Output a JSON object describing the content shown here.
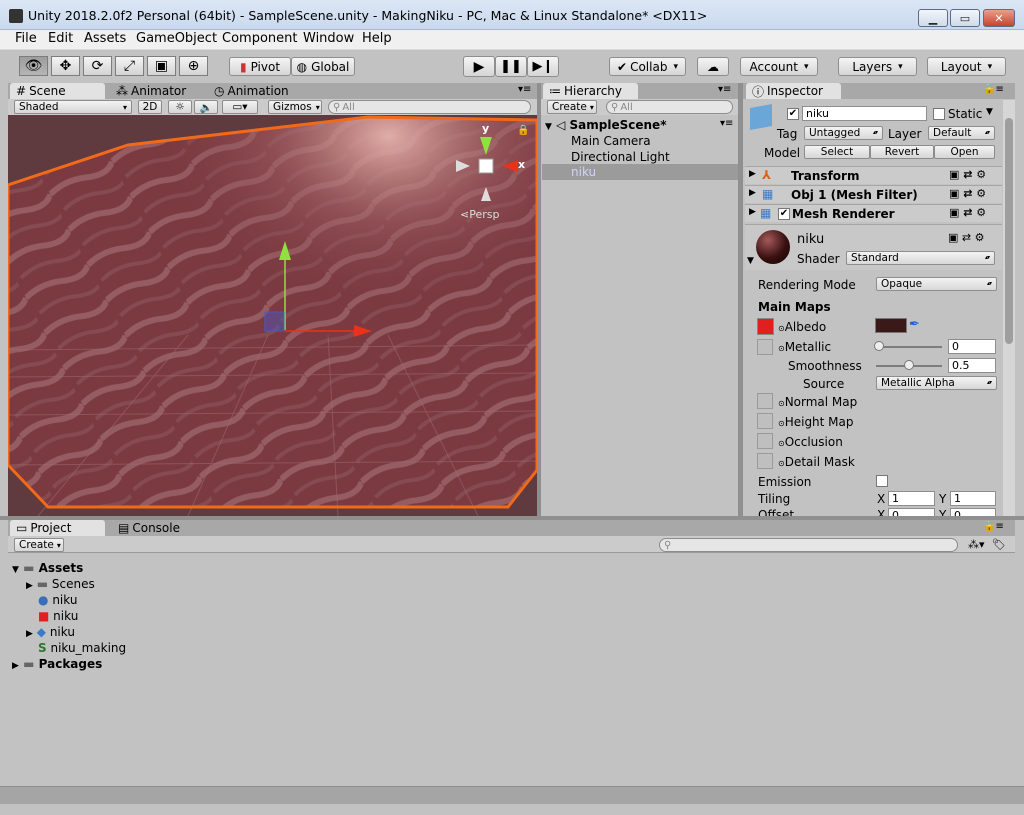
{
  "window": {
    "title": "Unity 2018.2.0f2 Personal (64bit) - SampleScene.unity - MakingNiku - PC, Mac & Linux Standalone* <DX11>",
    "minimize_label": "▁",
    "maximize_label": "▭",
    "close_label": "✕"
  },
  "menu": [
    "File",
    "Edit",
    "Assets",
    "GameObject",
    "Component",
    "Window",
    "Help"
  ],
  "toolbar": {
    "pivot_label": "Pivot",
    "global_label": "Global",
    "collab_label": "Collab",
    "account_label": "Account",
    "layers_label": "Layers",
    "layout_label": "Layout"
  },
  "scene": {
    "tabs": [
      "Scene",
      "Animator",
      "Animation"
    ],
    "shading_mode": "Shaded",
    "mode_2d_label": "2D",
    "gizmos_label": "Gizmos",
    "search_placeholder": "All",
    "projection_label": "Persp",
    "axis_x_label": "x",
    "axis_y_label": "y"
  },
  "hierarchy": {
    "tab_label": "Hierarchy",
    "create_label": "Create",
    "search_placeholder": "All",
    "scene_name": "SampleScene*",
    "items": [
      "Main Camera",
      "Directional Light",
      "niku"
    ],
    "selected_item": "niku"
  },
  "inspector": {
    "tab_label": "Inspector",
    "object_name": "niku",
    "static_label": "Static",
    "tag_label": "Tag",
    "tag_value": "Untagged",
    "layer_label": "Layer",
    "layer_value": "Default",
    "model_label": "Model",
    "model_buttons": [
      "Select",
      "Revert",
      "Open"
    ],
    "components": [
      "Transform",
      "Obj 1 (Mesh Filter)",
      "Mesh Renderer"
    ],
    "material_name": "niku",
    "shader_label": "Shader",
    "shader_value": "Standard",
    "rendering_mode_label": "Rendering Mode",
    "rendering_mode_value": "Opaque",
    "main_maps_label": "Main Maps",
    "albedo_label": "Albedo",
    "albedo_color": "#3a1a18",
    "metallic_label": "Metallic",
    "metallic_value": "0",
    "smoothness_label": "Smoothness",
    "smoothness_value": "0.5",
    "source_label": "Source",
    "source_value": "Metallic Alpha",
    "normal_map_label": "Normal Map",
    "height_map_label": "Height Map",
    "occlusion_label": "Occlusion",
    "detail_mask_label": "Detail Mask",
    "emission_label": "Emission",
    "tiling_label": "Tiling",
    "tiling_x": "1",
    "tiling_y": "1",
    "offset_label": "Offset",
    "offset_x": "0",
    "offset_y": "0",
    "x_label": "X",
    "y_label": "Y"
  },
  "project": {
    "tabs": [
      "Project",
      "Console"
    ],
    "create_label": "Create",
    "tree": {
      "assets": "Assets",
      "scenes": "Scenes",
      "niku_material": "niku",
      "niku_texture": "niku",
      "niku_model": "niku",
      "niku_script": "niku_making",
      "packages": "Packages"
    }
  },
  "colors": {
    "selection_outline": "#f06a1a",
    "mesh_color": "#7a3a40",
    "gizmo_y": "#8fe040",
    "gizmo_x": "#e8321a",
    "selection_highlight": "#9b9b9b",
    "selected_text": "#d0d4f8"
  }
}
